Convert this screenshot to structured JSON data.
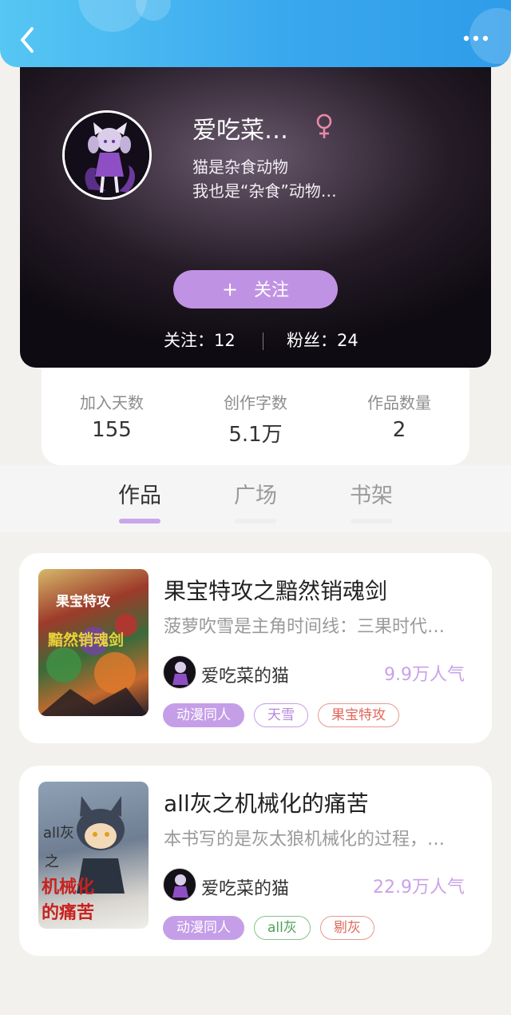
{
  "header": {
    "back_icon": "chevron-left-icon",
    "more_icon": "more-dots-icon",
    "color": "#3aa8ee"
  },
  "profile": {
    "nickname": "爱吃菜…",
    "gender": "female",
    "gender_color": "#e88aa6",
    "bio_line1": "猫是杂食动物",
    "bio_line2": "我也是“杂食”动物…",
    "follow_label": "关注",
    "follow_plus": "+",
    "following_label": "关注：12",
    "followers_label": "粉丝：24"
  },
  "stats": [
    {
      "label": "加入天数",
      "value": "155"
    },
    {
      "label": "创作字数",
      "value": "5.1万"
    },
    {
      "label": "作品数量",
      "value": "2"
    }
  ],
  "tabs": [
    {
      "label": "作品",
      "active": true
    },
    {
      "label": "广场",
      "active": false
    },
    {
      "label": "书架",
      "active": false
    }
  ],
  "books": [
    {
      "title": "果宝特攻之黯然销魂剑",
      "desc": "菠萝吹雪是主角时间线：三果时代…",
      "author": "爱吃菜的猫",
      "popularity": "9.9万人气",
      "tags": [
        "动漫同人",
        "天雪",
        "果宝特攻"
      ],
      "cover_line1": "果宝特攻",
      "cover_line2": "黯然销魂剑"
    },
    {
      "title": "all灰之机械化的痛苦",
      "desc": "本书写的是灰太狼机械化的过程，…",
      "author": "爱吃菜的猫",
      "popularity": "22.9万人气",
      "tags": [
        "动漫同人",
        "all灰",
        "剔灰"
      ],
      "cover_line1": "all灰",
      "cover_line2": "之",
      "cover_line3": "机械化",
      "cover_line4": "的痛苦"
    }
  ]
}
